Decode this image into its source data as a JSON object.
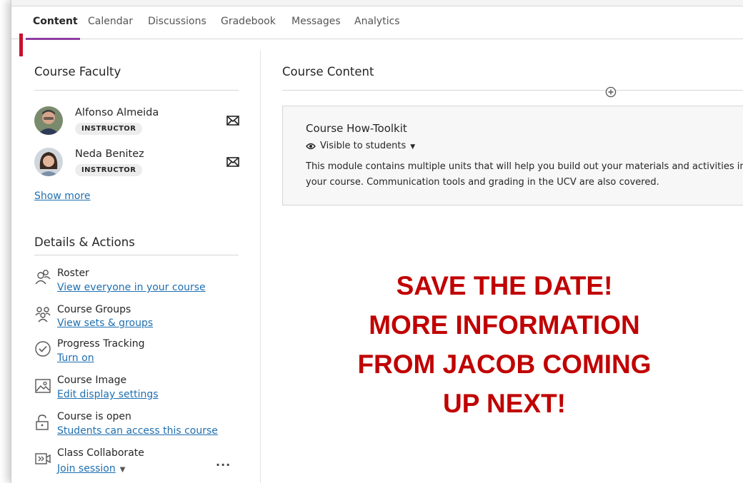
{
  "tabs": {
    "items": [
      "Content",
      "Calendar",
      "Discussions",
      "Gradebook",
      "Messages",
      "Analytics"
    ],
    "active": "Content"
  },
  "faculty": {
    "title": "Course Faculty",
    "members": [
      {
        "name": "Alfonso Almeida",
        "role": "INSTRUCTOR"
      },
      {
        "name": "Neda Benitez",
        "role": "INSTRUCTOR"
      }
    ],
    "show_more": "Show more"
  },
  "details": {
    "title": "Details & Actions",
    "items": [
      {
        "title": "Roster",
        "link": "View everyone in your course",
        "icon": "roster-icon"
      },
      {
        "title": "Course Groups",
        "link": "View sets & groups",
        "icon": "groups-icon"
      },
      {
        "title": "Progress Tracking",
        "link": "Turn on",
        "icon": "progress-check-icon"
      },
      {
        "title": "Course Image",
        "link": "Edit display settings",
        "icon": "image-icon"
      },
      {
        "title": "Course is open",
        "link": "Students can access this course",
        "icon": "unlock-icon"
      },
      {
        "title": "Class Collaborate",
        "link": "Join session",
        "icon": "collaborate-icon"
      }
    ],
    "more": "..."
  },
  "content": {
    "title": "Course Content",
    "module": {
      "title": "Course How-Toolkit",
      "visibility": "Visible to students",
      "description": "This module contains multiple units that will help you build out your materials and activities in your course. Communication tools and grading in the UCV are also covered."
    }
  },
  "announcement": {
    "lines": [
      "SAVE THE DATE!",
      "MORE INFORMATION",
      "FROM JACOB COMING",
      "UP NEXT!"
    ],
    "color": "#c00000"
  },
  "colors": {
    "accent": "#c8102e",
    "tab_underline": "#8e3fa2",
    "link": "#1f6fb0"
  }
}
